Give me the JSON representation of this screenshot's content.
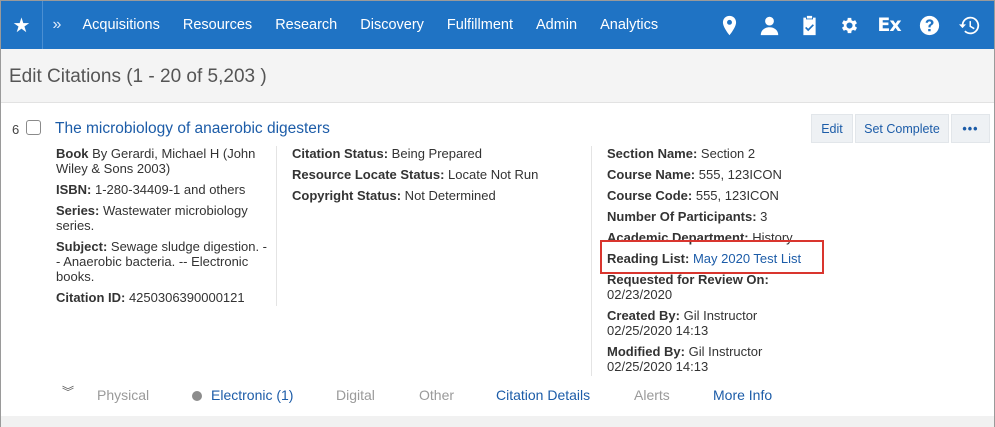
{
  "nav": {
    "menu": [
      "Acquisitions",
      "Resources",
      "Research",
      "Discovery",
      "Fulfillment",
      "Admin",
      "Analytics"
    ],
    "ex_label": "Ex",
    "icons": [
      "star-icon",
      "chevron-right-icon",
      "location-pin-icon",
      "user-icon",
      "clipboard-check-icon",
      "gear-icon",
      "ex-icon",
      "help-icon",
      "history-icon"
    ]
  },
  "page": {
    "title": "Edit Citations (1 - 20 of 5,203 )"
  },
  "record": {
    "number": "6",
    "title": "The microbiology of anaerobic digesters",
    "buttons": {
      "edit": "Edit",
      "set_complete": "Set Complete",
      "more": "•••"
    },
    "col1": {
      "book_label": "Book",
      "book_value": " By Gerardi, Michael H (John Wiley & Sons 2003)",
      "isbn_label": "ISBN:",
      "isbn_value": " 1-280-34409-1 and others",
      "series_label": "Series:",
      "series_value": " Wastewater microbiology series.",
      "subject_label": "Subject:",
      "subject_value": " Sewage sludge digestion. -- Anaerobic bacteria. -- Electronic books.",
      "citation_id_label": "Citation ID:",
      "citation_id_value": " 4250306390000121"
    },
    "col2": {
      "status_label": "Citation Status:",
      "status_value": "  Being Prepared",
      "locate_label": "Resource Locate Status:",
      "locate_value": " Locate Not Run",
      "copyright_label": "Copyright Status:",
      "copyright_value": " Not Determined"
    },
    "col3": {
      "section_label": "Section Name:",
      "section_value": " Section 2",
      "course_name_label": "Course Name:",
      "course_name_value": " 555, 123ICON",
      "course_code_label": "Course Code:",
      "course_code_value": " 555, 123ICON",
      "participants_label": "Number Of Participants:",
      "participants_value": " 3",
      "department_label": "Academic Department:",
      "department_value": " History",
      "reading_list_label": "Reading List:",
      "reading_list_value": "May 2020 Test List",
      "review_label": "Requested for Review On:",
      "review_value": "02/23/2020",
      "created_label": "Created By:",
      "created_value": " Gil Instructor",
      "created_date": "02/25/2020 14:13",
      "modified_label": "Modified By:",
      "modified_value": " Gil Instructor",
      "modified_date": "02/25/2020 14:13"
    },
    "tabs": {
      "physical": "Physical",
      "electronic": "Electronic (1)",
      "digital": "Digital",
      "other": "Other",
      "citation_details": "Citation Details",
      "alerts": "Alerts",
      "more_info": "More Info"
    }
  },
  "colors": {
    "nav_bg": "#1f73c4",
    "link": "#1c5ca8",
    "highlight": "#d9352e"
  }
}
